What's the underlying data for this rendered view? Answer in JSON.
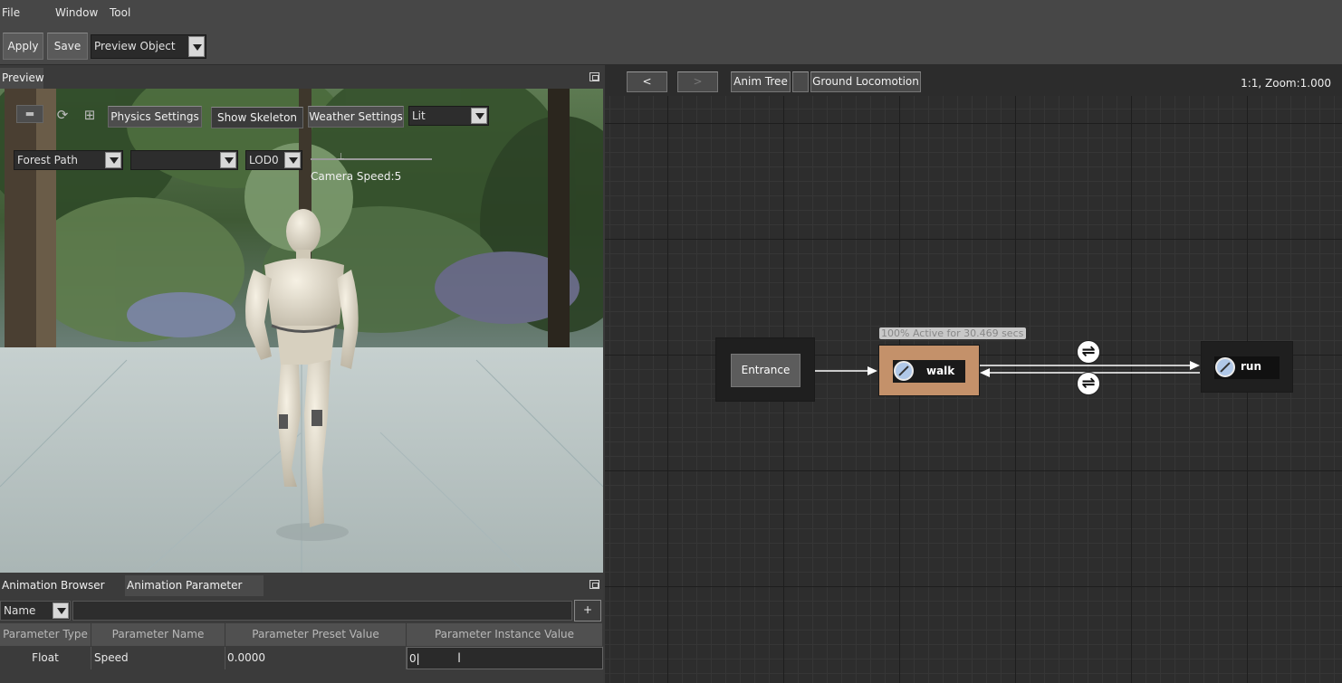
{
  "menu": {
    "file": "File",
    "window": "Window",
    "tool": "Tool"
  },
  "toolbar": {
    "apply": "Apply",
    "save": "Save",
    "preview_object": "Preview Object"
  },
  "preview_panel": {
    "tab": "Preview",
    "buttons": {
      "physics_settings": "Physics Settings",
      "show_skeleton": "Show Skeleton",
      "weather_settings": "Weather Settings",
      "lighting": "Lit"
    },
    "scene": "Forest Path",
    "scene2": "",
    "lod": "LOD0",
    "camera_speed": "Camera Speed:5",
    "camera_speed_value": 5
  },
  "bottom_panel": {
    "tabs": [
      "Animation Browser",
      "Animation Parameter"
    ],
    "filter": "Name",
    "add_label": "+",
    "columns": [
      "Parameter Type",
      "Parameter Name",
      "Parameter Preset Value",
      "Parameter Instance Value"
    ],
    "rows": [
      {
        "type": "Float",
        "name": "Speed",
        "preset": "0.0000",
        "instance": "0"
      }
    ]
  },
  "graph": {
    "back": "<",
    "forward": ">",
    "breadcrumb": [
      "Anim Tree",
      "Ground Locomotion"
    ],
    "zoom": "1:1, Zoom:1.000",
    "nodes": {
      "entrance": "Entrance",
      "walk": "walk",
      "run": "run"
    },
    "tooltip": "100% Active for 30.469 secs"
  },
  "colors": {
    "active_node": "#c4916a",
    "node_dark": "#1f1f1f",
    "entrance_box": "#5c5c5c"
  },
  "icons": [
    "filter-icon",
    "refresh-icon",
    "grid-icon",
    "state-icon",
    "transition-icon",
    "float-panel-icon",
    "text-cursor-icon"
  ]
}
